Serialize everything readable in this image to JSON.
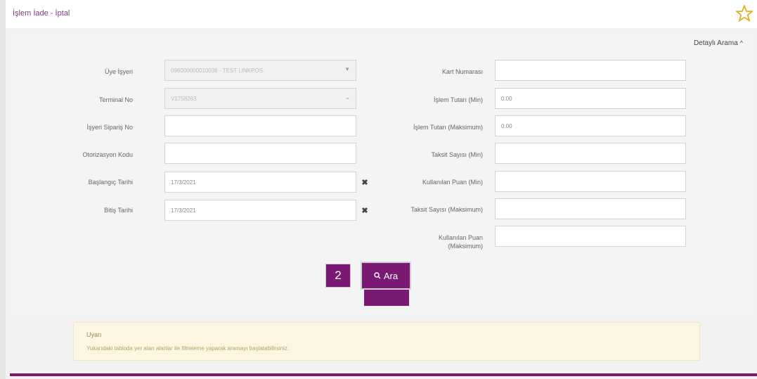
{
  "page": {
    "title": "İşlem İade - İptal"
  },
  "panel": {
    "detail_toggle": "Detaylı Arama"
  },
  "form": {
    "uye_isyeri": {
      "label": "Üye İşyeri",
      "value": "096000000010036 - TEST LINKPOS"
    },
    "terminal_no": {
      "label": "Terminal No",
      "value": "V1758263"
    },
    "isyeri_siparis_no": {
      "label": "İşyeri Sipariş No",
      "value": ""
    },
    "otorizasyon_kodu": {
      "label": "Otorizasyon Kodu",
      "value": ""
    },
    "baslangic_tarihi": {
      "label": "Başlangıç Tarihi",
      "value": "17/3/2021"
    },
    "bitis_tarihi": {
      "label": "Bitiş Tarihi",
      "value": "17/3/2021"
    },
    "kart_numarasi": {
      "label": "Kart Numarası",
      "value": ""
    },
    "islem_tutari_min": {
      "label": "İşlem Tutarı (Min)",
      "value": "0.00"
    },
    "islem_tutari_maks": {
      "label": "İşlem Tutarı (Maksimum)",
      "value": "0.00"
    },
    "taksit_sayisi_min": {
      "label": "Taksit Sayısı (Min)",
      "value": ""
    },
    "kullanilan_puan_min": {
      "label": "Kullanılan Puan (Min)",
      "value": ""
    },
    "taksit_sayisi_maks": {
      "label": "Taksit Sayısı (Maksimum)",
      "value": ""
    },
    "kullanilan_puan_maks": {
      "label": "Kullanılan Puan (Maksimum)",
      "value": ""
    }
  },
  "actions": {
    "search_label": "Ara",
    "step_number": "2"
  },
  "alert": {
    "title": "Uyarı",
    "text": "Yukarıdaki tabloda yer alan alanlar ile filtreleme yaparak aramayı başlatabilirsiniz."
  },
  "colors": {
    "brand": "#7b1a73",
    "star": "#e0b020",
    "alert_bg": "#fbf5e2"
  }
}
